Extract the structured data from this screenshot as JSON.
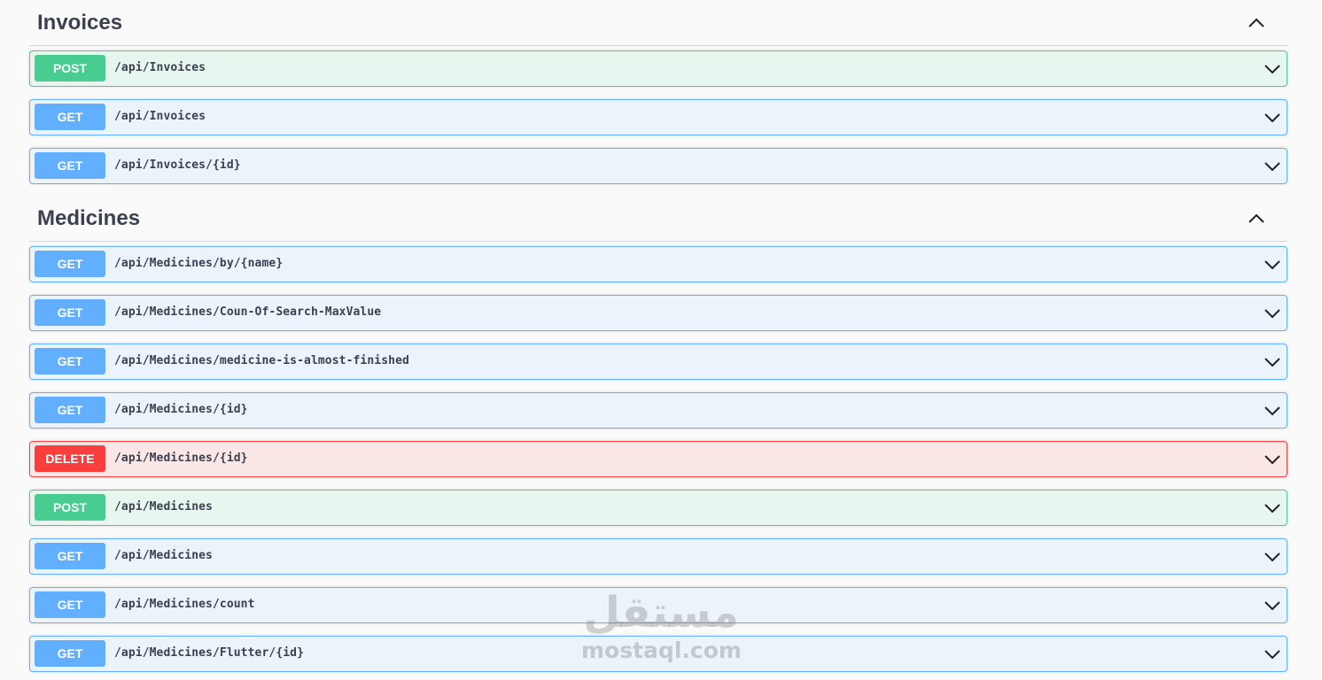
{
  "sections": [
    {
      "title": "Invoices",
      "operations": [
        {
          "method": "POST",
          "path": "/api/Invoices"
        },
        {
          "method": "GET",
          "path": "/api/Invoices"
        },
        {
          "method": "GET",
          "path": "/api/Invoices/{id}"
        }
      ]
    },
    {
      "title": "Medicines",
      "operations": [
        {
          "method": "GET",
          "path": "/api/Medicines/by/{name}"
        },
        {
          "method": "GET",
          "path": "/api/Medicines/Coun-Of-Search-MaxValue"
        },
        {
          "method": "GET",
          "path": "/api/Medicines/medicine-is-almost-finished"
        },
        {
          "method": "GET",
          "path": "/api/Medicines/{id}"
        },
        {
          "method": "DELETE",
          "path": "/api/Medicines/{id}"
        },
        {
          "method": "POST",
          "path": "/api/Medicines"
        },
        {
          "method": "GET",
          "path": "/api/Medicines"
        },
        {
          "method": "GET",
          "path": "/api/Medicines/count"
        },
        {
          "method": "GET",
          "path": "/api/Medicines/Flutter/{id}"
        }
      ]
    }
  ],
  "watermark": {
    "arabic": "مستقل",
    "text": "mostaql.com"
  },
  "icons": {
    "section_toggle": "chevron-up-icon",
    "operation_toggle": "chevron-down-icon"
  },
  "colors": {
    "get": "#61affe",
    "post": "#49cc90",
    "delete": "#f93e3e",
    "title": "#3b4151"
  }
}
